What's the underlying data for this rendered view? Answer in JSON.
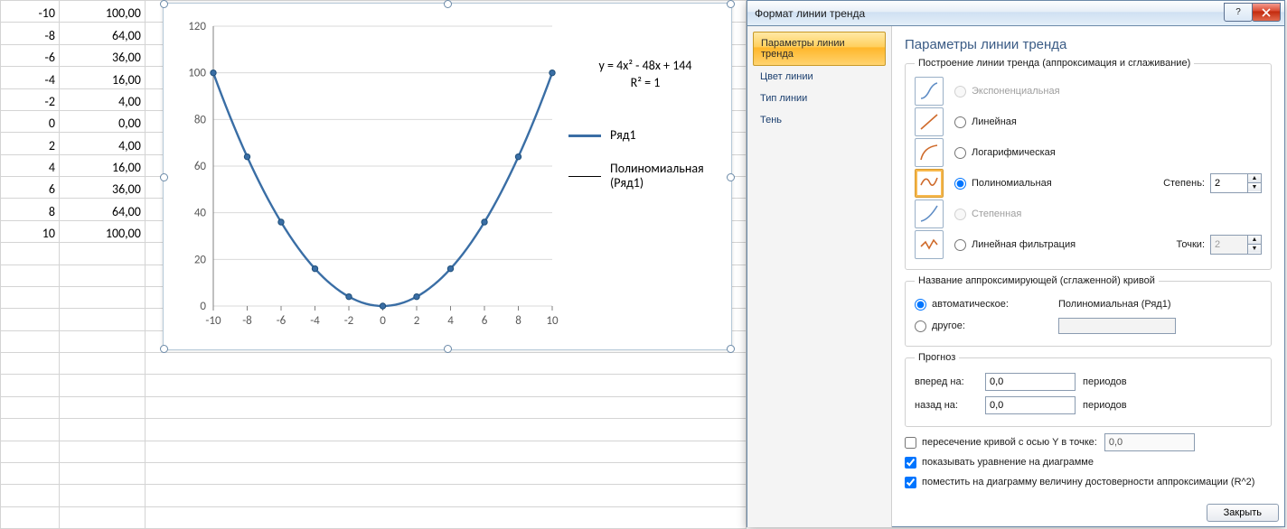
{
  "table": {
    "rows": [
      {
        "x": -10,
        "y": "100,00"
      },
      {
        "x": -8,
        "y": "64,00"
      },
      {
        "x": -6,
        "y": "36,00"
      },
      {
        "x": -4,
        "y": "16,00"
      },
      {
        "x": -2,
        "y": "4,00"
      },
      {
        "x": 0,
        "y": "0,00"
      },
      {
        "x": 2,
        "y": "4,00"
      },
      {
        "x": 4,
        "y": "16,00"
      },
      {
        "x": 6,
        "y": "36,00"
      },
      {
        "x": 8,
        "y": "64,00"
      },
      {
        "x": 10,
        "y": "100,00"
      }
    ]
  },
  "chart_data": {
    "type": "line",
    "x": [
      -10,
      -8,
      -6,
      -4,
      -2,
      0,
      2,
      4,
      6,
      8,
      10
    ],
    "series": [
      {
        "name": "Ряд1",
        "values": [
          100,
          64,
          36,
          16,
          4,
          0,
          4,
          16,
          36,
          64,
          100
        ],
        "color": "#3a6ea5"
      },
      {
        "name": "Полиномиальная (Ряд1)",
        "values": [
          100,
          64,
          36,
          16,
          4,
          0,
          4,
          16,
          36,
          64,
          100
        ],
        "color": "#000000",
        "role": "trendline"
      }
    ],
    "xlim": [
      -10,
      10
    ],
    "xticks": [
      -10,
      -8,
      -6,
      -4,
      -2,
      0,
      2,
      4,
      6,
      8,
      10
    ],
    "ylim": [
      0,
      120
    ],
    "yticks": [
      0,
      20,
      40,
      60,
      80,
      100,
      120
    ],
    "equation": "y = 4x² - 48x + 144",
    "r2": "R² = 1"
  },
  "legend": {
    "series1": "Ряд1",
    "trend": "Полиномиальная\n(Ряд1)"
  },
  "dialog": {
    "title": "Формат линии тренда",
    "nav": {
      "params": "Параметры линии тренда",
      "line_color": "Цвет линии",
      "line_type": "Тип линии",
      "shadow": "Тень"
    },
    "heading": "Параметры линии тренда",
    "group_build": "Построение линии тренда (аппроксимация и сглаживание)",
    "opts": {
      "exp": "Экспоненциальная",
      "linear": "Линейная",
      "log": "Логарифмическая",
      "poly": "Полиномиальная",
      "degree_label": "Степень:",
      "degree_value": "2",
      "power": "Степенная",
      "ma": "Линейная фильтрация",
      "ma_points_label": "Точки:",
      "ma_points_value": "2"
    },
    "group_name": "Название аппроксимирующей (сглаженной) кривой",
    "name_auto": "автоматическое:",
    "name_auto_value": "Полиномиальная (Ряд1)",
    "name_other": "другое:",
    "name_other_value": "",
    "group_forecast": "Прогноз",
    "fc_fwd_label": "вперед на:",
    "fc_fwd_value": "0,0",
    "fc_bwd_label": "назад на:",
    "fc_bwd_value": "0,0",
    "fc_unit": "периодов",
    "intercept": "пересечение кривой с осью Y в точке:",
    "intercept_value": "0,0",
    "show_eq": "показывать уравнение на диаграмме",
    "show_r2": "поместить на диаграмму величину достоверности аппроксимации (R^2)",
    "close": "Закрыть"
  }
}
